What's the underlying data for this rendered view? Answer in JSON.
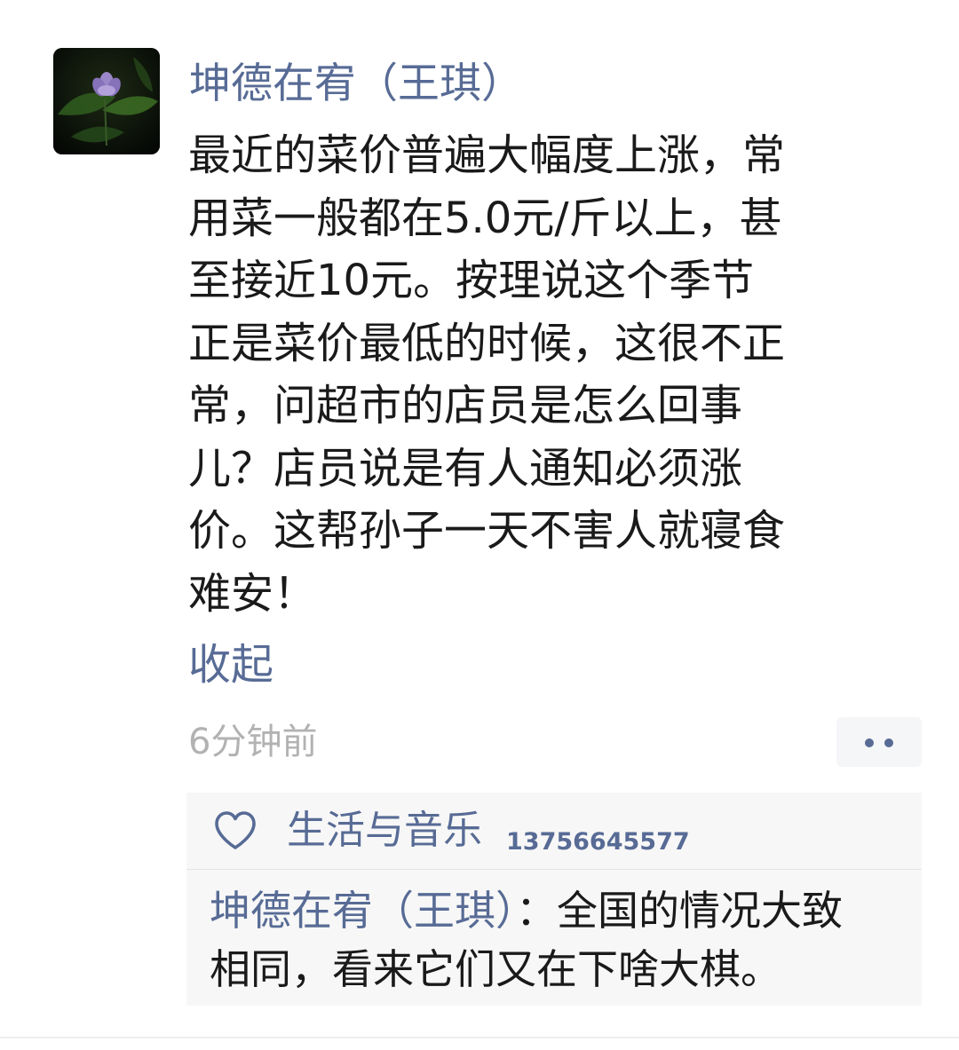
{
  "post": {
    "author_name": "坤德在宥（王琪）",
    "content_lines": [
      "最近的菜价普遍大幅度上涨，常",
      "用菜一般都在5.0元/斤以上，甚",
      "至接近10元。按理说这个季节",
      "正是菜价最低的时候，这很不正",
      "常，问超市的店员是怎么回事",
      "儿？店员说是有人通知必须涨",
      "价。这帮孙子一天不害人就寝食",
      "难安！"
    ],
    "collapse_label": "收起",
    "timestamp": "6分钟前",
    "avatar_icon": "lotus-flower-avatar",
    "more_icon": "two-dots-icon"
  },
  "likes": {
    "icon": "heart-outline-icon",
    "name": "生活与音乐",
    "sub": "13756645577"
  },
  "comment": {
    "author": "坤德在宥（王琪）",
    "line1_text": "：全国的情况大致",
    "line2_text": "相同，看来它们又在下啥大棋。"
  },
  "colors": {
    "link": "#576b95",
    "text": "#1a1a1a",
    "muted": "#b2b2b2",
    "panel": "#f7f7f7"
  }
}
